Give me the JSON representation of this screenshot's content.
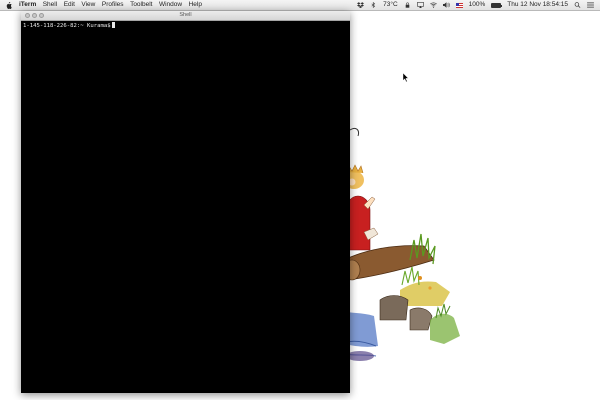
{
  "menubar": {
    "apple_icon": "apple-icon",
    "app_name": "iTerm",
    "menus": [
      "Shell",
      "Edit",
      "View",
      "Profiles",
      "Toolbelt",
      "Window",
      "Help"
    ],
    "temperature": "73°C",
    "battery_percent": "100%",
    "battery_level": 1.0,
    "datetime": "Thu 12 Nov  18:54:15",
    "status_icons": [
      "dropbox-icon",
      "bluetooth-icon",
      "lock-icon",
      "airplay-icon",
      "wifi-icon",
      "volume-icon",
      "us-flag-icon",
      "battery-icon",
      "search-icon",
      "list-icon"
    ]
  },
  "window": {
    "title": "Shell",
    "terminal_prompt": "1-145-118-226-82:~ Kurama$"
  },
  "colors": {
    "terminal_bg": "#000000",
    "terminal_fg": "#e8e8e8",
    "desktop_bg": "#ffffff"
  }
}
